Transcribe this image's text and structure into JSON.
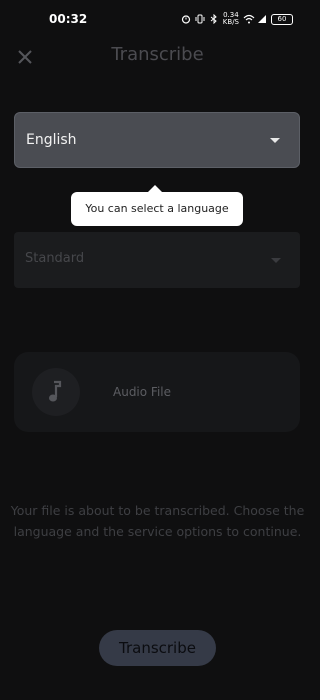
{
  "status_bar": {
    "time": "00:32",
    "network_speed_value": "0.34",
    "network_speed_unit": "KB/S",
    "battery": "60"
  },
  "header": {
    "title": "Transcribe",
    "close_icon": "close-icon"
  },
  "language_select": {
    "value": "English",
    "icon": "dropdown-arrow-icon"
  },
  "tooltip": {
    "text": "You can select a language"
  },
  "service_select": {
    "value": "Standard",
    "icon": "dropdown-arrow-icon"
  },
  "audio_file": {
    "label": "Audio File",
    "icon": "music-note-icon"
  },
  "info": {
    "text": "Your file is about to be transcribed. Choose the language and the service options to continue."
  },
  "actions": {
    "transcribe_label": "Transcribe"
  }
}
